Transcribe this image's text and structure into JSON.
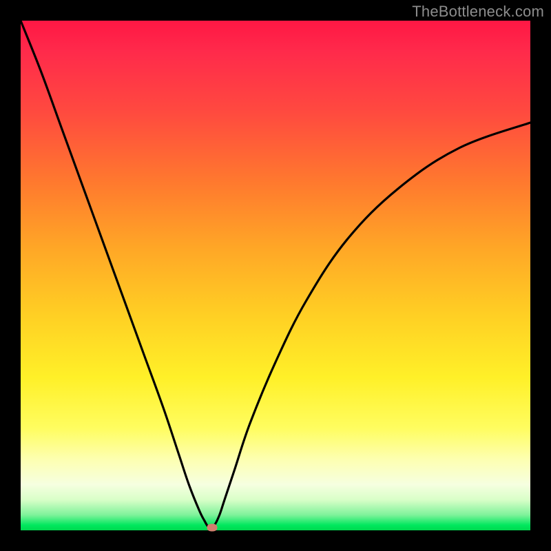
{
  "watermark": "TheBottleneck.com",
  "colors": {
    "page_bg": "#000000",
    "curve": "#000000",
    "marker": "#d07f6e",
    "gradient_stops": [
      "#ff1744",
      "#ff2a4b",
      "#ff4a3f",
      "#ff7a2e",
      "#ffa826",
      "#ffd024",
      "#fff028",
      "#fffd60",
      "#fdffb0",
      "#f6ffe0",
      "#d9ffc8",
      "#7ef29a",
      "#00e85e",
      "#00d94f"
    ]
  },
  "chart_data": {
    "type": "line",
    "title": "",
    "xlabel": "",
    "ylabel": "",
    "xlim": [
      0,
      100
    ],
    "ylim": [
      0,
      100
    ],
    "note": "V-shaped bottleneck curve; y≈0 is optimal (green), y≈100 is worst (red). Minimum near x≈37.",
    "series": [
      {
        "name": "bottleneck-curve",
        "x": [
          0,
          4,
          8,
          12,
          16,
          20,
          24,
          28,
          31,
          33,
          35,
          36,
          37,
          38,
          39,
          40,
          42,
          45,
          50,
          56,
          64,
          74,
          86,
          100
        ],
        "y": [
          100,
          90,
          79,
          68,
          57,
          46,
          35,
          24,
          15,
          9,
          4,
          2,
          0.5,
          1,
          3,
          6,
          12,
          21,
          33,
          45,
          57,
          67,
          75,
          80
        ]
      }
    ],
    "marker": {
      "x": 37.5,
      "y": 0.6
    }
  }
}
